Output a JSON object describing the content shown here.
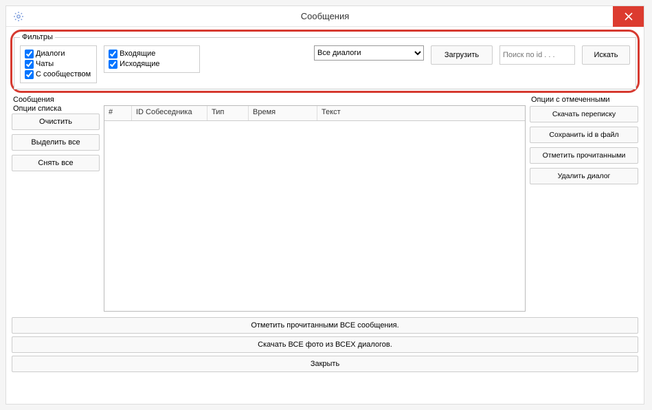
{
  "window": {
    "title": "Сообщения"
  },
  "filters": {
    "legend": "Фильтры",
    "group1": {
      "dialogs": "Диалоги",
      "chats": "Чаты",
      "community": "С сообществом"
    },
    "group2": {
      "incoming": "Входящие",
      "outgoing": "Исходящие"
    },
    "select_value": "Все диалоги",
    "load_btn": "Загрузить",
    "search_placeholder": "Поиск по id . . .",
    "search_btn": "Искать"
  },
  "left": {
    "label1": "Сообщения",
    "label2": "Опции списка",
    "clear": "Очистить",
    "select_all": "Выделить все",
    "deselect_all": "Снять все"
  },
  "table": {
    "cols": {
      "num": "#",
      "id": "ID Собеседника",
      "type": "Тип",
      "time": "Время",
      "text": "Текст"
    }
  },
  "right": {
    "label": "Опции с отмеченными",
    "download": "Скачать переписку",
    "save_id": "Сохранить id в файл",
    "mark_read": "Отметить прочитанными",
    "delete": "Удалить диалог"
  },
  "bottom": {
    "mark_all": "Отметить прочитанными ВСЕ сообщения.",
    "download_photos": "Скачать ВСЕ фото из ВСЕХ диалогов.",
    "close": "Закрыть"
  }
}
